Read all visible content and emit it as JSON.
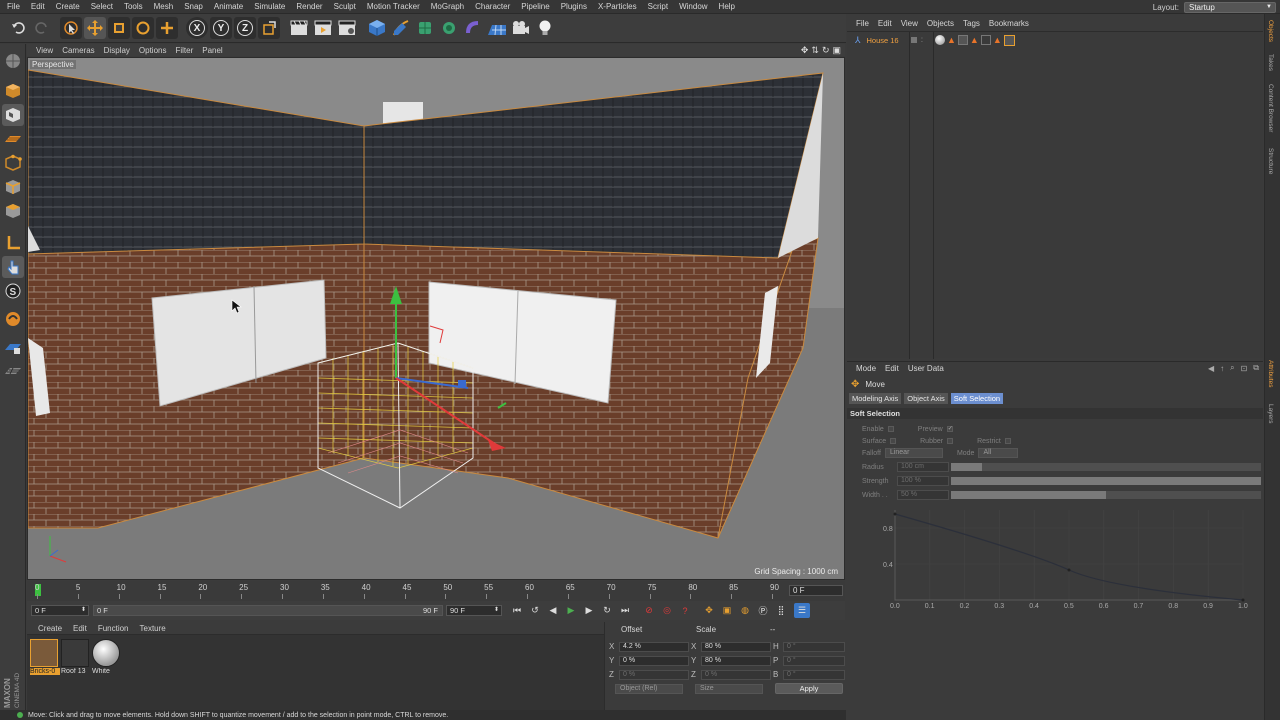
{
  "menubar": {
    "items": [
      "File",
      "Edit",
      "Create",
      "Select",
      "Tools",
      "Mesh",
      "Snap",
      "Animate",
      "Simulate",
      "Render",
      "Sculpt",
      "Motion Tracker",
      "MoGraph",
      "Character",
      "Pipeline",
      "Plugins",
      "X-Particles",
      "Script",
      "Window",
      "Help"
    ],
    "layout_label": "Layout:",
    "layout_value": "Startup"
  },
  "toolbar": {
    "axis_buttons": [
      "X",
      "Y",
      "Z"
    ]
  },
  "viewport": {
    "menu": [
      "View",
      "Cameras",
      "Display",
      "Options",
      "Filter",
      "Panel"
    ],
    "camera_label": "Perspective",
    "grid_spacing": "Grid Spacing : 1000 cm"
  },
  "timeline": {
    "ticks": [
      "0",
      "5",
      "10",
      "15",
      "20",
      "25",
      "30",
      "35",
      "40",
      "45",
      "50",
      "55",
      "60",
      "65",
      "70",
      "75",
      "80",
      "85",
      "90"
    ],
    "current_frame": "0 F"
  },
  "playback": {
    "start": "0 F",
    "range_start": "0 F",
    "range_end": "90 F",
    "end": "90 F"
  },
  "materials": {
    "menu": [
      "Create",
      "Edit",
      "Function",
      "Texture"
    ],
    "items": [
      {
        "name": "Bricks-0",
        "color": "#7a5a3a"
      },
      {
        "name": "Roof 13",
        "color": "#3a3a3a"
      },
      {
        "name": "White",
        "color": "#dcdcdc"
      }
    ]
  },
  "coordinates": {
    "headers": [
      "Offset",
      "Scale",
      "--"
    ],
    "rows": [
      {
        "axis": "X",
        "offset": "4.2 %",
        "scale_axis": "X",
        "scale": "80 %",
        "rot_axis": "H",
        "rot": "0 °"
      },
      {
        "axis": "Y",
        "offset": "0 %",
        "scale_axis": "Y",
        "scale": "80 %",
        "rot_axis": "P",
        "rot": "0 °"
      },
      {
        "axis": "Z",
        "offset": "0 %",
        "scale_axis": "Z",
        "scale": "0 %",
        "rot_axis": "B",
        "rot": "0 °"
      }
    ],
    "mode_dropdown": "Object (Rel)",
    "size_dropdown": "Size",
    "apply": "Apply"
  },
  "status": {
    "text": "Move: Click and drag to move elements. Hold down SHIFT to quantize movement / add to the selection in point mode, CTRL to remove."
  },
  "object_manager": {
    "menu": [
      "File",
      "Edit",
      "View",
      "Objects",
      "Tags",
      "Bookmarks"
    ],
    "object_name": "House 16"
  },
  "attribute_manager": {
    "menu": [
      "Mode",
      "Edit",
      "User Data"
    ],
    "tool_name": "Move",
    "tabs": [
      "Modeling Axis",
      "Object Axis",
      "Soft Selection"
    ],
    "section": "Soft Selection",
    "enable_label": "Enable",
    "preview_label": "Preview",
    "surface_label": "Surface",
    "rubber_label": "Rubber",
    "restrict_label": "Restrict",
    "falloff_label": "Falloff",
    "falloff_value": "Linear",
    "mode_label": "Mode",
    "mode_value": "All",
    "radius_label": "Radius",
    "radius_value": "100 cm",
    "strength_label": "Strength",
    "strength_value": "100 %",
    "width_label": "Width . .",
    "width_value": "50 %",
    "graph_y_labels": [
      "0.8",
      "0.4"
    ],
    "graph_x_labels": [
      "0.0",
      "0.1",
      "0.2",
      "0.3",
      "0.4",
      "0.5",
      "0.6",
      "0.7",
      "0.8",
      "0.9",
      "1.0"
    ]
  },
  "right_tabs": [
    "Objects",
    "Takes",
    "Content Browser",
    "Structure",
    "Attributes",
    "Layers"
  ],
  "brand": {
    "line1": "MAXON",
    "line2": "CINEMA 4D"
  }
}
